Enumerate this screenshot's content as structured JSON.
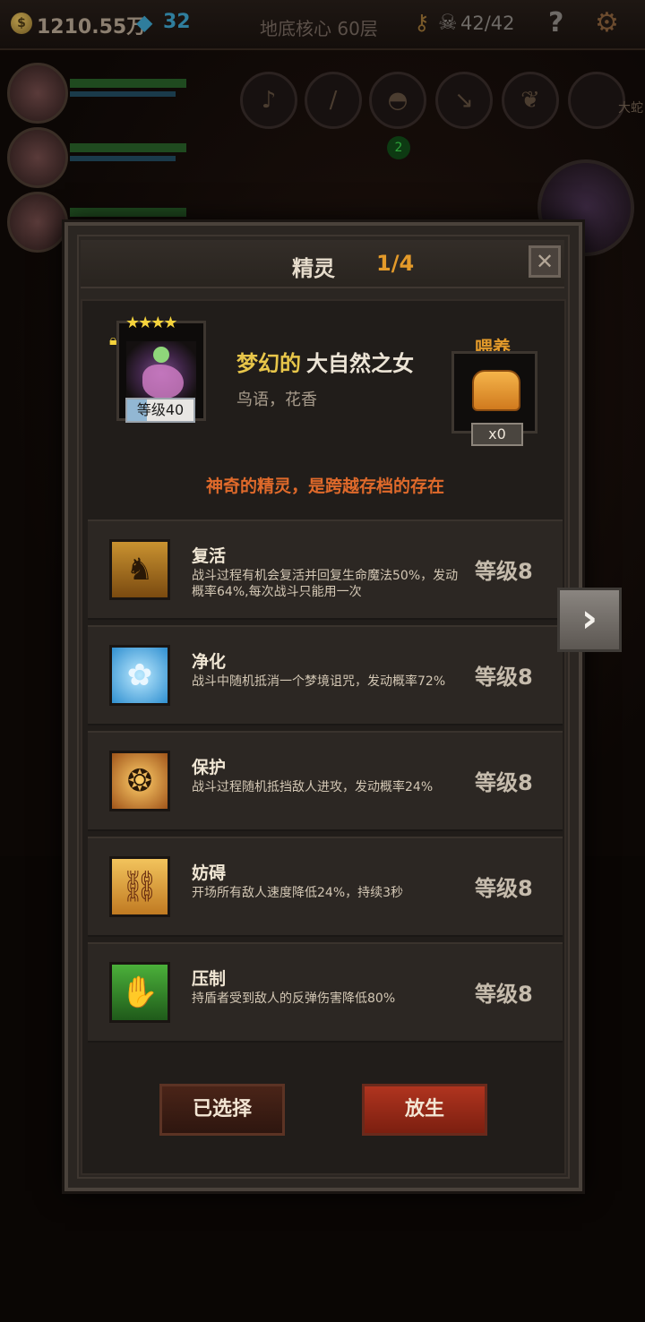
{
  "topbar": {
    "coin_symbol": "$",
    "coins": "1210.55万",
    "gems": "32",
    "floor": "地底核心 60层",
    "skulls": "42/42",
    "help_symbol": "?"
  },
  "background": {
    "badge": "2",
    "side_text": "大蛇"
  },
  "modal": {
    "title": "精灵",
    "page": "1/4",
    "close_symbol": "✕",
    "spirit": {
      "stars": "★★★★",
      "star_count": 4,
      "level": "等级40",
      "name_prefix": "梦幻的",
      "name": "大自然之女",
      "traits": "鸟语，花香",
      "description": "神奇的精灵，是跨越存档的存在"
    },
    "feed": {
      "label": "喂养",
      "count": "x0"
    },
    "skills": [
      {
        "name": "复活",
        "desc": "战斗过程有机会复活并回复生命魔法50%，发动概率64%,每次战斗只能用一次",
        "level": "等级8"
      },
      {
        "name": "净化",
        "desc": "战斗中随机抵消一个梦境诅咒，发动概率72%",
        "level": "等级8"
      },
      {
        "name": "保护",
        "desc": "战斗过程随机抵挡敌人进攻，发动概率24%",
        "level": "等级8"
      },
      {
        "name": "妨碍",
        "desc": "开场所有敌人速度降低24%，持续3秒",
        "level": "等级8"
      },
      {
        "name": "压制",
        "desc": "持盾者受到敌人的反弹伤害降低80%",
        "level": "等级8"
      }
    ],
    "buttons": {
      "selected": "已选择",
      "release": "放生"
    }
  },
  "colors": {
    "accent_orange": "#e39a2a",
    "name_gold": "#e8c64a",
    "desc_orange": "#e06a2b",
    "release_red": "#b0341f"
  }
}
